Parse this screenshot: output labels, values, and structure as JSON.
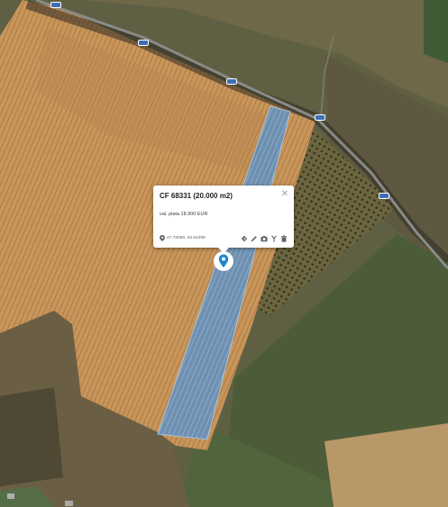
{
  "map": {
    "type": "satellite",
    "colors": {
      "wheat_field": "#c8955a",
      "corridor": "#5b9bd5",
      "orchard": "#5a5432",
      "grassland": "#4c5c38",
      "road": "#8a8a86",
      "marker": "#1e88c8",
      "shield": "#3f6fb3"
    }
  },
  "popup": {
    "title": "CF 68331 (20.000 m2)",
    "close_icon": "close-icon",
    "description": "val. piata 18.900 EUR",
    "coordinates": "47.75098, 26.64399",
    "actions": [
      "directions-icon",
      "edit-icon",
      "camera-icon",
      "style-icon",
      "delete-icon"
    ]
  },
  "marker": {
    "icon": "map-pin-icon"
  }
}
